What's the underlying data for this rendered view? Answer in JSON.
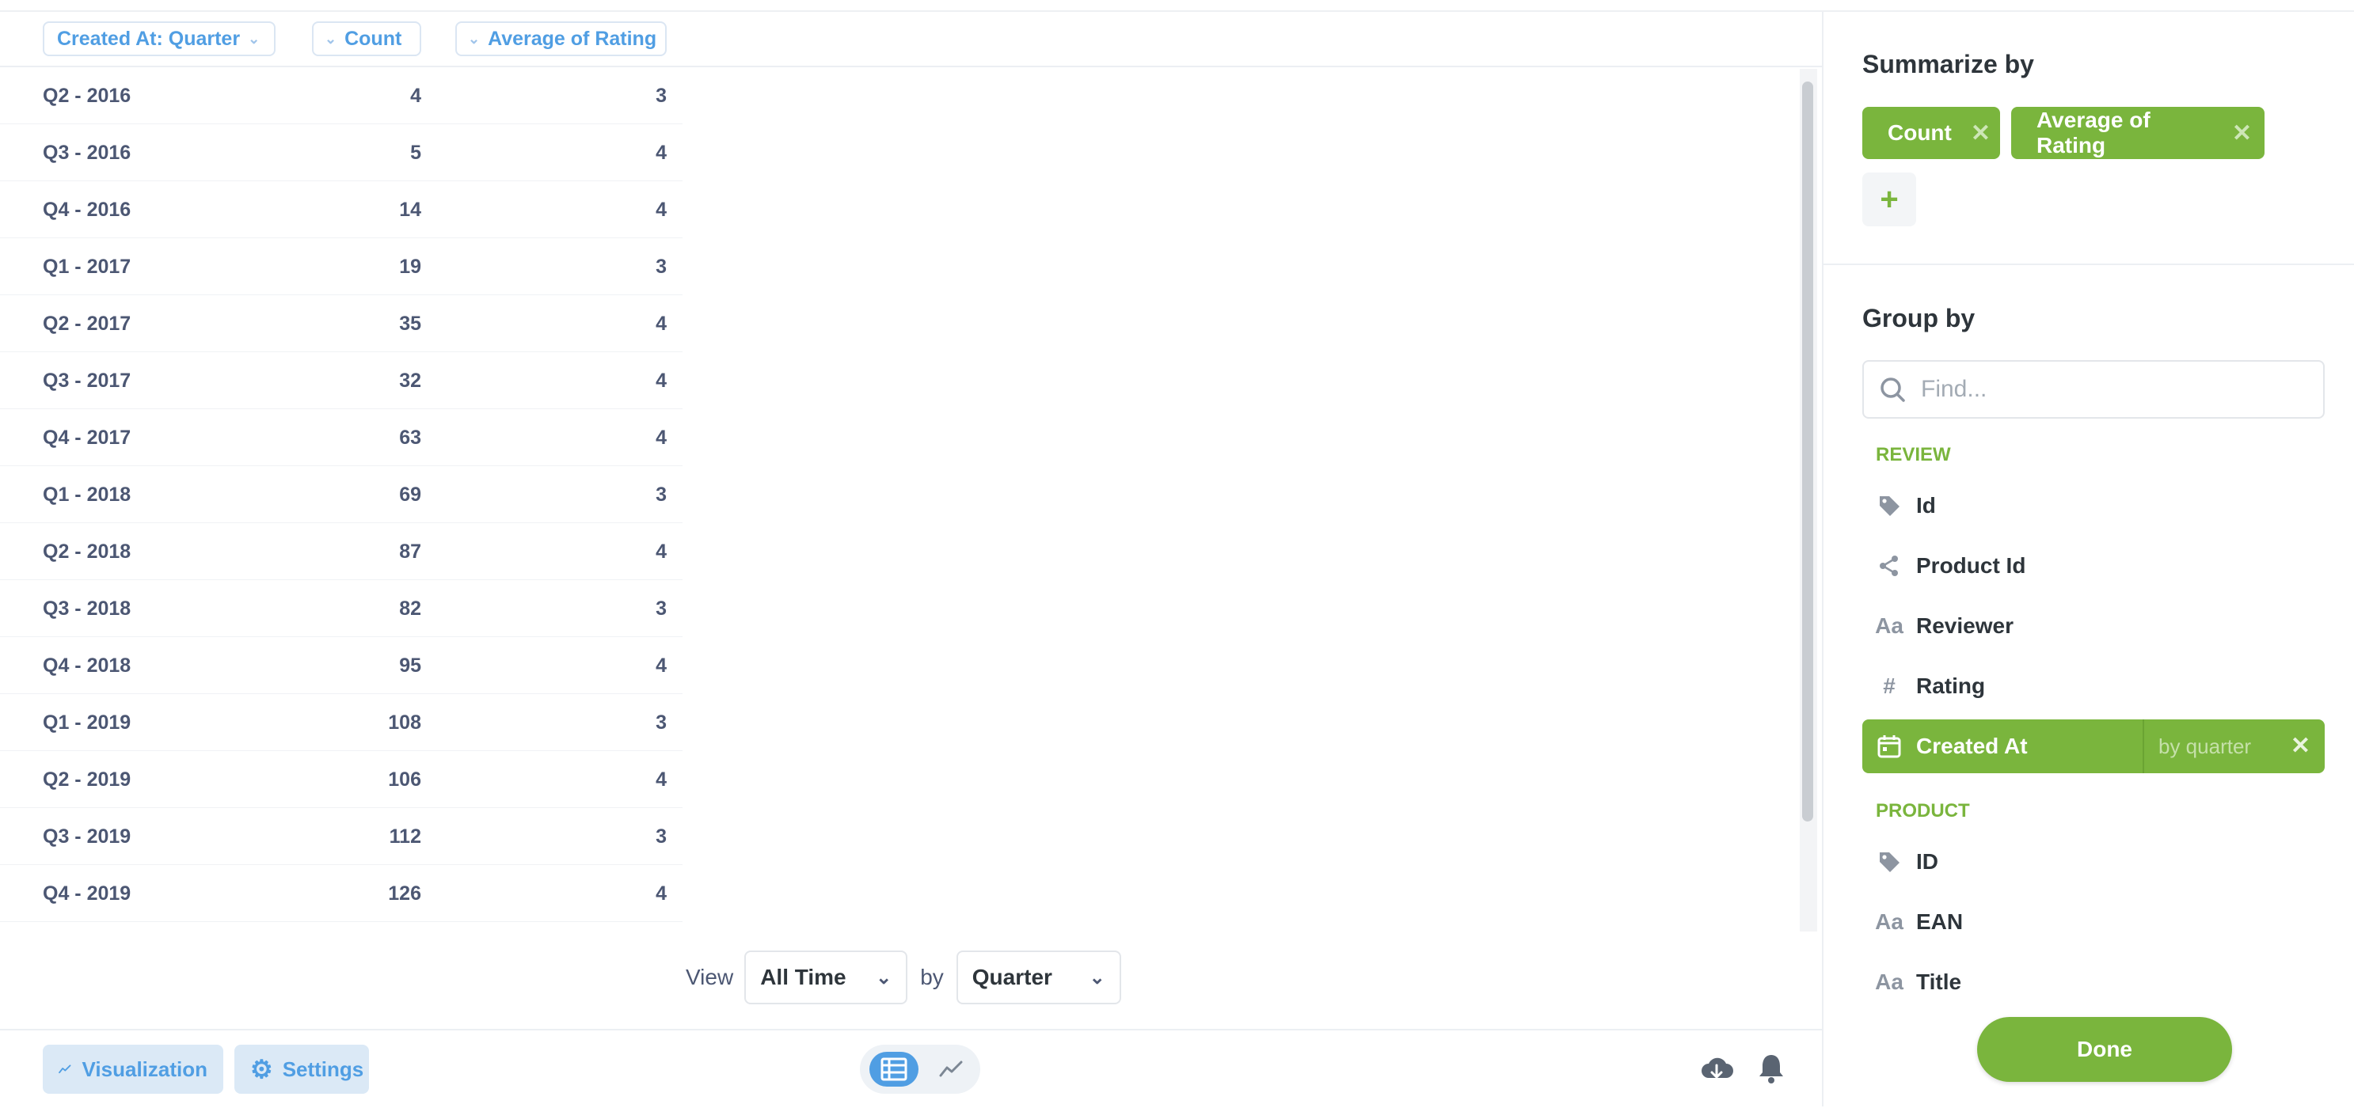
{
  "table": {
    "columns": [
      {
        "label": "Created At: Quarter"
      },
      {
        "label": "Count"
      },
      {
        "label": "Average of Rating"
      }
    ],
    "rows": [
      [
        "Q2 - 2016",
        "4",
        "3"
      ],
      [
        "Q3 - 2016",
        "5",
        "4"
      ],
      [
        "Q4 - 2016",
        "14",
        "4"
      ],
      [
        "Q1 - 2017",
        "19",
        "3"
      ],
      [
        "Q2 - 2017",
        "35",
        "4"
      ],
      [
        "Q3 - 2017",
        "32",
        "4"
      ],
      [
        "Q4 - 2017",
        "63",
        "4"
      ],
      [
        "Q1 - 2018",
        "69",
        "3"
      ],
      [
        "Q2 - 2018",
        "87",
        "4"
      ],
      [
        "Q3 - 2018",
        "82",
        "3"
      ],
      [
        "Q4 - 2018",
        "95",
        "4"
      ],
      [
        "Q1 - 2019",
        "108",
        "3"
      ],
      [
        "Q2 - 2019",
        "106",
        "4"
      ],
      [
        "Q3 - 2019",
        "112",
        "3"
      ],
      [
        "Q4 - 2019",
        "126",
        "4"
      ]
    ]
  },
  "view_controls": {
    "view_label": "View",
    "range_value": "All Time",
    "by_label": "by",
    "unit_value": "Quarter"
  },
  "bottom_bar": {
    "visualization_label": "Visualization",
    "settings_label": "Settings"
  },
  "sidebar": {
    "summarize_title": "Summarize by",
    "metrics": [
      {
        "label": "Count"
      },
      {
        "label": "Average of Rating"
      }
    ],
    "group_title": "Group by",
    "search_placeholder": "Find...",
    "groups": [
      {
        "title": "REVIEW",
        "items": [
          {
            "label": "Id",
            "icon": "tag-icon"
          },
          {
            "label": "Product Id",
            "icon": "connection-icon"
          },
          {
            "label": "Reviewer",
            "icon": "text-type-icon"
          },
          {
            "label": "Rating",
            "icon": "number-icon"
          },
          {
            "label": "Created At",
            "icon": "calendar-icon",
            "active": true,
            "bucket": "by quarter"
          }
        ]
      },
      {
        "title": "PRODUCT",
        "items": [
          {
            "label": "ID",
            "icon": "tag-icon"
          },
          {
            "label": "EAN",
            "icon": "text-type-icon"
          },
          {
            "label": "Title",
            "icon": "text-type-icon"
          }
        ]
      }
    ],
    "done_label": "Done"
  },
  "colors": {
    "brand_blue": "#509ee3",
    "summarize_green": "#7ab53d",
    "text_dark": "#2e353b"
  }
}
